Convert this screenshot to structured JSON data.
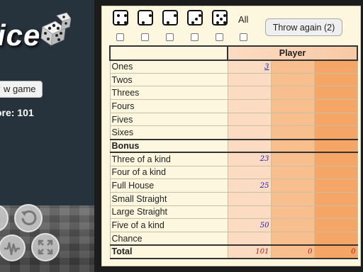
{
  "left_panel": {
    "logo_text": "ice",
    "new_game_label": "w game",
    "score_text": "ore: 101",
    "icons": [
      "undo-icon",
      "sound-icon",
      "fullscreen-icon"
    ]
  },
  "dice": {
    "faces": [
      4,
      2,
      2,
      3,
      5
    ],
    "all_label": "All",
    "throw_label": "Throw again (2)"
  },
  "scorecard": {
    "player_header": "Player",
    "rows": [
      {
        "label": "Ones",
        "value": "3",
        "link": true
      },
      {
        "label": "Twos",
        "value": ""
      },
      {
        "label": "Threes",
        "value": ""
      },
      {
        "label": "Fours",
        "value": ""
      },
      {
        "label": "Fives",
        "value": ""
      },
      {
        "label": "Sixes",
        "value": ""
      },
      {
        "label": "Bonus",
        "value": "",
        "type": "bonus"
      },
      {
        "label": "Three of a kind",
        "value": "23"
      },
      {
        "label": "Four of a kind",
        "value": ""
      },
      {
        "label": "Full House",
        "value": "25"
      },
      {
        "label": "Small Straight",
        "value": ""
      },
      {
        "label": "Large Straight",
        "value": ""
      },
      {
        "label": "Five of a kind",
        "value": "50"
      },
      {
        "label": "Chance",
        "value": ""
      }
    ],
    "total": {
      "label": "Total",
      "values": [
        "101",
        "0",
        "0"
      ]
    }
  },
  "colors": {
    "column_1": "#fbdcc3",
    "column_2": "#f8be8d",
    "column_3": "#f5a666",
    "value_text": "#1b1bb2",
    "total_text": "#c31a1a"
  }
}
